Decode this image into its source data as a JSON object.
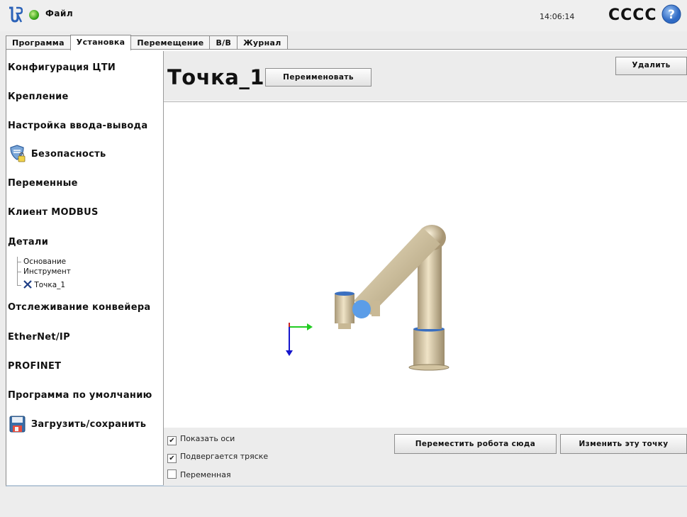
{
  "header": {
    "file_menu": "Файл",
    "time": "14:06:14",
    "robot_name": "CCCC"
  },
  "tabs": [
    {
      "label": "Программа",
      "active": false
    },
    {
      "label": "Установка",
      "active": true
    },
    {
      "label": "Перемещение",
      "active": false
    },
    {
      "label": "В/В",
      "active": false
    },
    {
      "label": "Журнал",
      "active": false
    }
  ],
  "sidebar": {
    "items": [
      {
        "label": "Конфигурация ЦТИ"
      },
      {
        "label": "Крепление"
      },
      {
        "label": "Настройка ввода-вывода"
      },
      {
        "label": "Безопасность",
        "icon": "safety-shield-icon"
      },
      {
        "label": "Переменные"
      },
      {
        "label": "Клиент MODBUS"
      },
      {
        "label": "Детали"
      },
      {
        "label": "Отслеживание конвейера"
      },
      {
        "label": "EtherNet/IP"
      },
      {
        "label": "PROFINET"
      },
      {
        "label": "Программа по умолчанию"
      },
      {
        "label": "Загрузить/сохранить",
        "icon": "floppy-disk-icon"
      }
    ],
    "features_tree": [
      {
        "label": "Основание"
      },
      {
        "label": "Инструмент"
      },
      {
        "label": "Точка_1",
        "icon": "point-feature-icon",
        "selected": true
      }
    ]
  },
  "main": {
    "title": "Точка_1",
    "rename_button": "Переименовать",
    "delete_button": "Удалить",
    "move_robot_button": "Переместить робота сюда",
    "change_point_button": "Изменить эту точку",
    "checkboxes": [
      {
        "label": "Показать оси",
        "checked": true
      },
      {
        "label": "Подвергается тряске",
        "checked": true
      },
      {
        "label": "Переменная",
        "checked": false
      }
    ]
  },
  "colors": {
    "accent_blue": "#3a6fc0",
    "axis_x": "#22cc22",
    "axis_z": "#1515cc",
    "axis_y": "#cc2222",
    "robot_body": "#d8c8a4",
    "tcp_marker": "#5b9de8"
  }
}
